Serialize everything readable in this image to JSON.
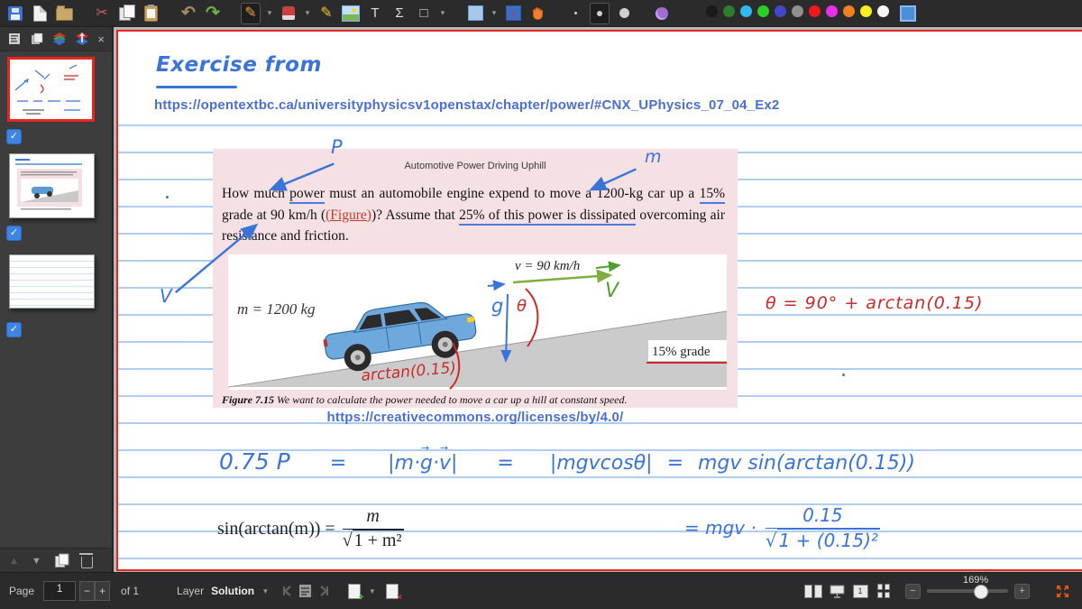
{
  "toolbar": {
    "palette": [
      "#1a1a1a",
      "#2d7d2d",
      "#30b8f0",
      "#28d028",
      "#4048c8",
      "#909090",
      "#f01818",
      "#e830e8",
      "#f08020",
      "#f8ee20",
      "#f5f5f5"
    ],
    "custom_color": "#4a90d9",
    "text_tool": "T",
    "math_tool": "Σ",
    "shape_tool": "□"
  },
  "sidebar": {
    "close": "×",
    "checkbox_glyph": "✓"
  },
  "page": {
    "heading": "Exercise from",
    "source_url": "https://opentextbc.ca/universityphysicsv1openstax/chapter/power/#CNX_UPhysics_07_04_Ex2",
    "cc_url": "https://creativecommons.org/licenses/by/4.0/",
    "problem": {
      "title": "Automotive Power Driving Uphill",
      "seg1": "How much ",
      "seg_power": "power",
      "seg2": " must an automobile engine expend to move a 1200-kg car up a ",
      "seg_grade": "15%",
      "seg3": " grade at 90 km/h (",
      "seg_figure": "(Figure)",
      "seg4": ")? Assume that ",
      "seg_dissipated": "25% of this power is dissipated",
      "seg5": " overcoming air resistance and friction."
    },
    "figure": {
      "mass": "m = 1200 kg",
      "speed": "v = 90 km/h",
      "grade": "15% grade",
      "caption_label": "Figure 7.15",
      "caption": " We want to calculate the power needed to move a car up a hill at constant speed."
    },
    "annotations": {
      "p": "P",
      "m": "m",
      "v": "V",
      "hand_v": "V",
      "g": "g",
      "theta": "θ",
      "arctan": "arctan(0.15)",
      "theta_eq": "θ = 90° + arctan(0.15)"
    },
    "work": {
      "t1": "0.75 P",
      "eq": "=",
      "bar": "|",
      "m_dot": "m·",
      "g": "g",
      "dot": "·",
      "v": "v",
      "t3": "|mgvcosθ|",
      "t4": "mgv sin(arctan(0.15))"
    },
    "typeset": {
      "lhs": "sin(arctan(m)) =",
      "num": "m",
      "radical": "√",
      "den": "1 + m²"
    },
    "hand_frac": {
      "prefix": "= mgv ·",
      "num": "0.15",
      "radical": "√",
      "den": "1 + (0.15)²"
    }
  },
  "statusbar": {
    "page_label": "Page",
    "page_value": "1",
    "minus": "−",
    "plus": "+",
    "of": "of 1",
    "layer_label": "Layer",
    "layer_value": "Solution",
    "caret": "▾",
    "page_fit_glyph": "1",
    "zoom": "169%"
  }
}
